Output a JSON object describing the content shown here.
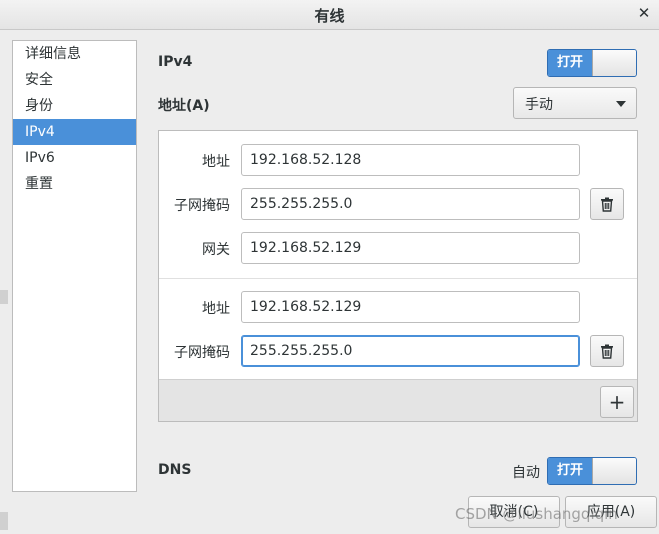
{
  "window": {
    "title": "有线"
  },
  "sidebar": {
    "items": [
      {
        "label": "详细信息"
      },
      {
        "label": "安全"
      },
      {
        "label": "身份"
      },
      {
        "label": "IPv4"
      },
      {
        "label": "IPv6"
      },
      {
        "label": "重置"
      }
    ],
    "selected": "IPv4"
  },
  "ipv4": {
    "heading": "IPv4",
    "toggle_label": "打开",
    "address_label": "地址(A)",
    "method": "手动",
    "entries": [
      {
        "address_label": "地址",
        "address": "192.168.52.128",
        "netmask_label": "子网掩码",
        "netmask": "255.255.255.0",
        "gateway_label": "网关",
        "gateway": "192.168.52.129"
      },
      {
        "address_label": "地址",
        "address": "192.168.52.129",
        "netmask_label": "子网掩码",
        "netmask": "255.255.255.0"
      }
    ],
    "add_label": "+"
  },
  "dns": {
    "heading": "DNS",
    "auto_label": "自动",
    "toggle_label": "打开"
  },
  "buttons": {
    "cancel": "取消(C)",
    "apply": "应用(A)"
  },
  "watermark": "CSDN @liushangqiqin",
  "colors": {
    "accent": "#4a90d9",
    "background": "#ededed"
  }
}
